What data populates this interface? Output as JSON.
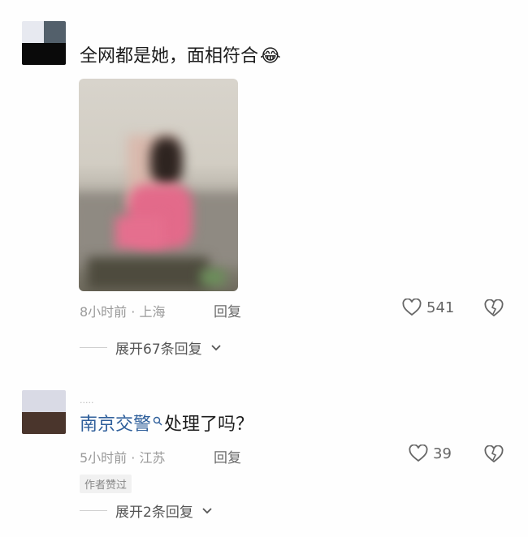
{
  "comments": [
    {
      "text": "全网都是她，面相符合",
      "emoji": "😂",
      "meta": "8小时前 · 上海",
      "reply": "回复",
      "likes": "541",
      "expand": "展开67条回复"
    },
    {
      "author": "南京交警",
      "text": "处理了吗？",
      "meta": "5小时前 · 江苏",
      "reply": "回复",
      "likes": "39",
      "tag": "作者赞过",
      "expand": "展开2条回复"
    }
  ],
  "colors": {
    "link": "#2f5f9b",
    "meta": "#9a9a9a"
  }
}
